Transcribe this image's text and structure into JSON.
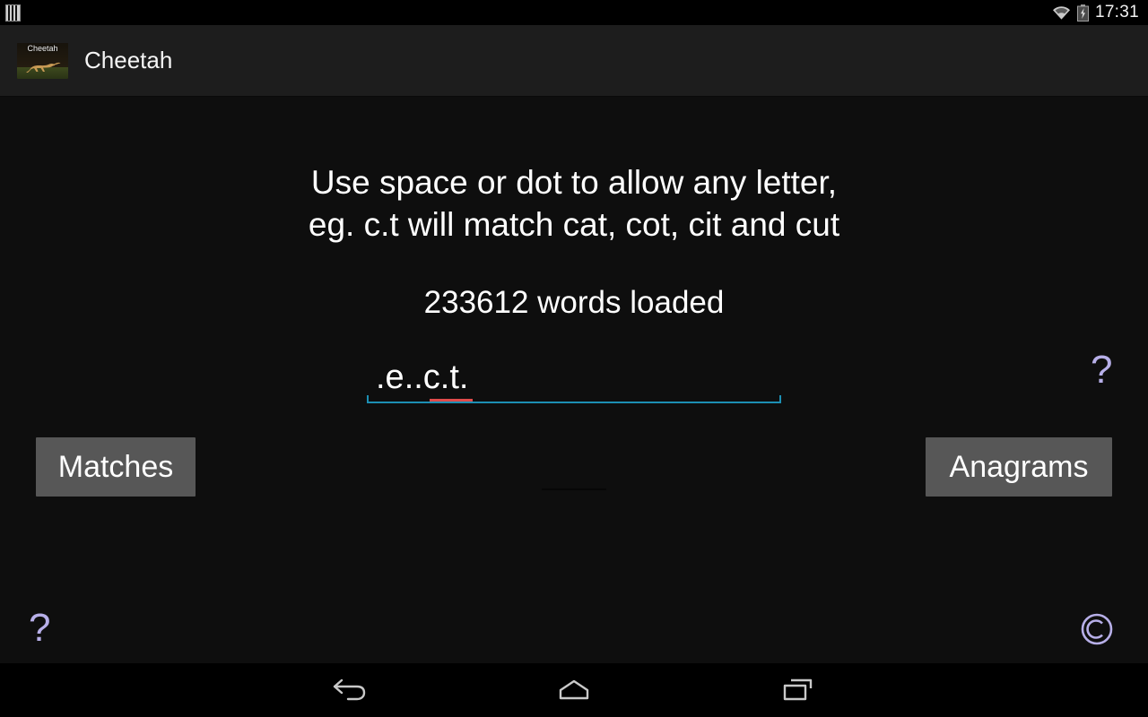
{
  "status_bar": {
    "notification_icon": "notification-bars-icon",
    "wifi_icon": "wifi-icon",
    "battery_icon": "battery-charging-icon",
    "time": "17:31"
  },
  "action_bar": {
    "app_icon_label": "Cheetah",
    "app_icon_name": "cheetah-app-icon",
    "title": "Cheetah"
  },
  "main": {
    "hint_line_1": "Use space or dot to allow any letter,",
    "hint_line_2": "eg. c.t will match cat, cot, cit and cut",
    "words_loaded": "233612 words loaded",
    "pattern_input": {
      "value": ".e..c.t.",
      "placeholder": "",
      "spellcheck_underline": true
    },
    "help_icon": "?",
    "copyright_icon": "©",
    "buttons": {
      "matches": "Matches",
      "anagrams": "Anagrams"
    }
  },
  "nav_bar": {
    "back_icon": "back-arrow-icon",
    "home_icon": "home-icon",
    "recents_icon": "recent-apps-icon"
  },
  "colors": {
    "background": "#0e0e0e",
    "action_bar": "#1d1d1d",
    "button": "#575757",
    "accent_underline": "#1c8fb3",
    "spellcheck": "#e04b4b",
    "help_purple": "#b7afe8",
    "text": "#ffffff"
  }
}
